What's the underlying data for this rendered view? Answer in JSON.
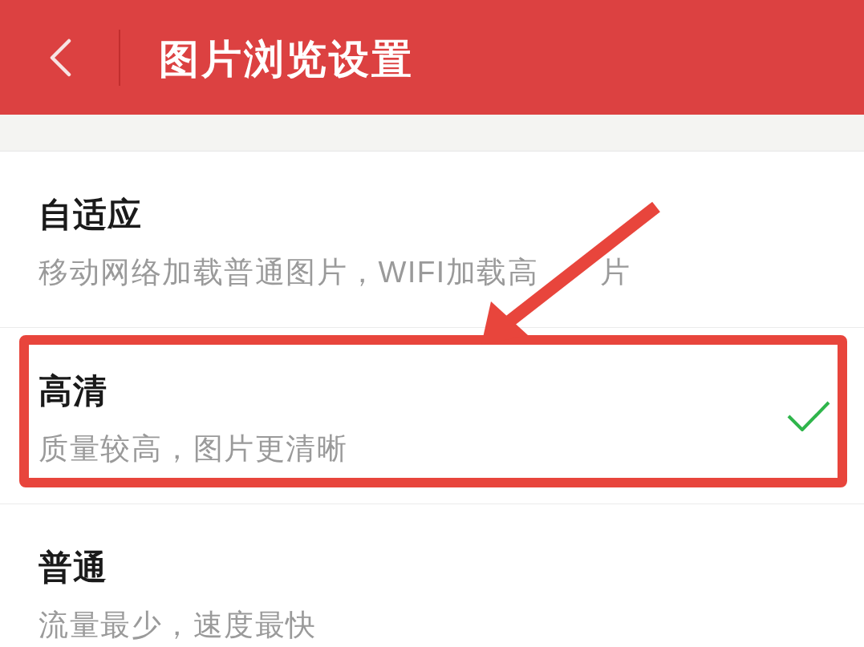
{
  "header": {
    "title": "图片浏览设置"
  },
  "options": [
    {
      "title": "自适应",
      "description": [
        "移动网络加载普通图片，WIFI加载高",
        "片"
      ],
      "selected": false
    },
    {
      "title": "高清",
      "description": [
        "质量较高，图片更清晰"
      ],
      "selected": true
    },
    {
      "title": "普通",
      "description": [
        "流量最少，速度最快"
      ],
      "selected": false
    }
  ]
}
